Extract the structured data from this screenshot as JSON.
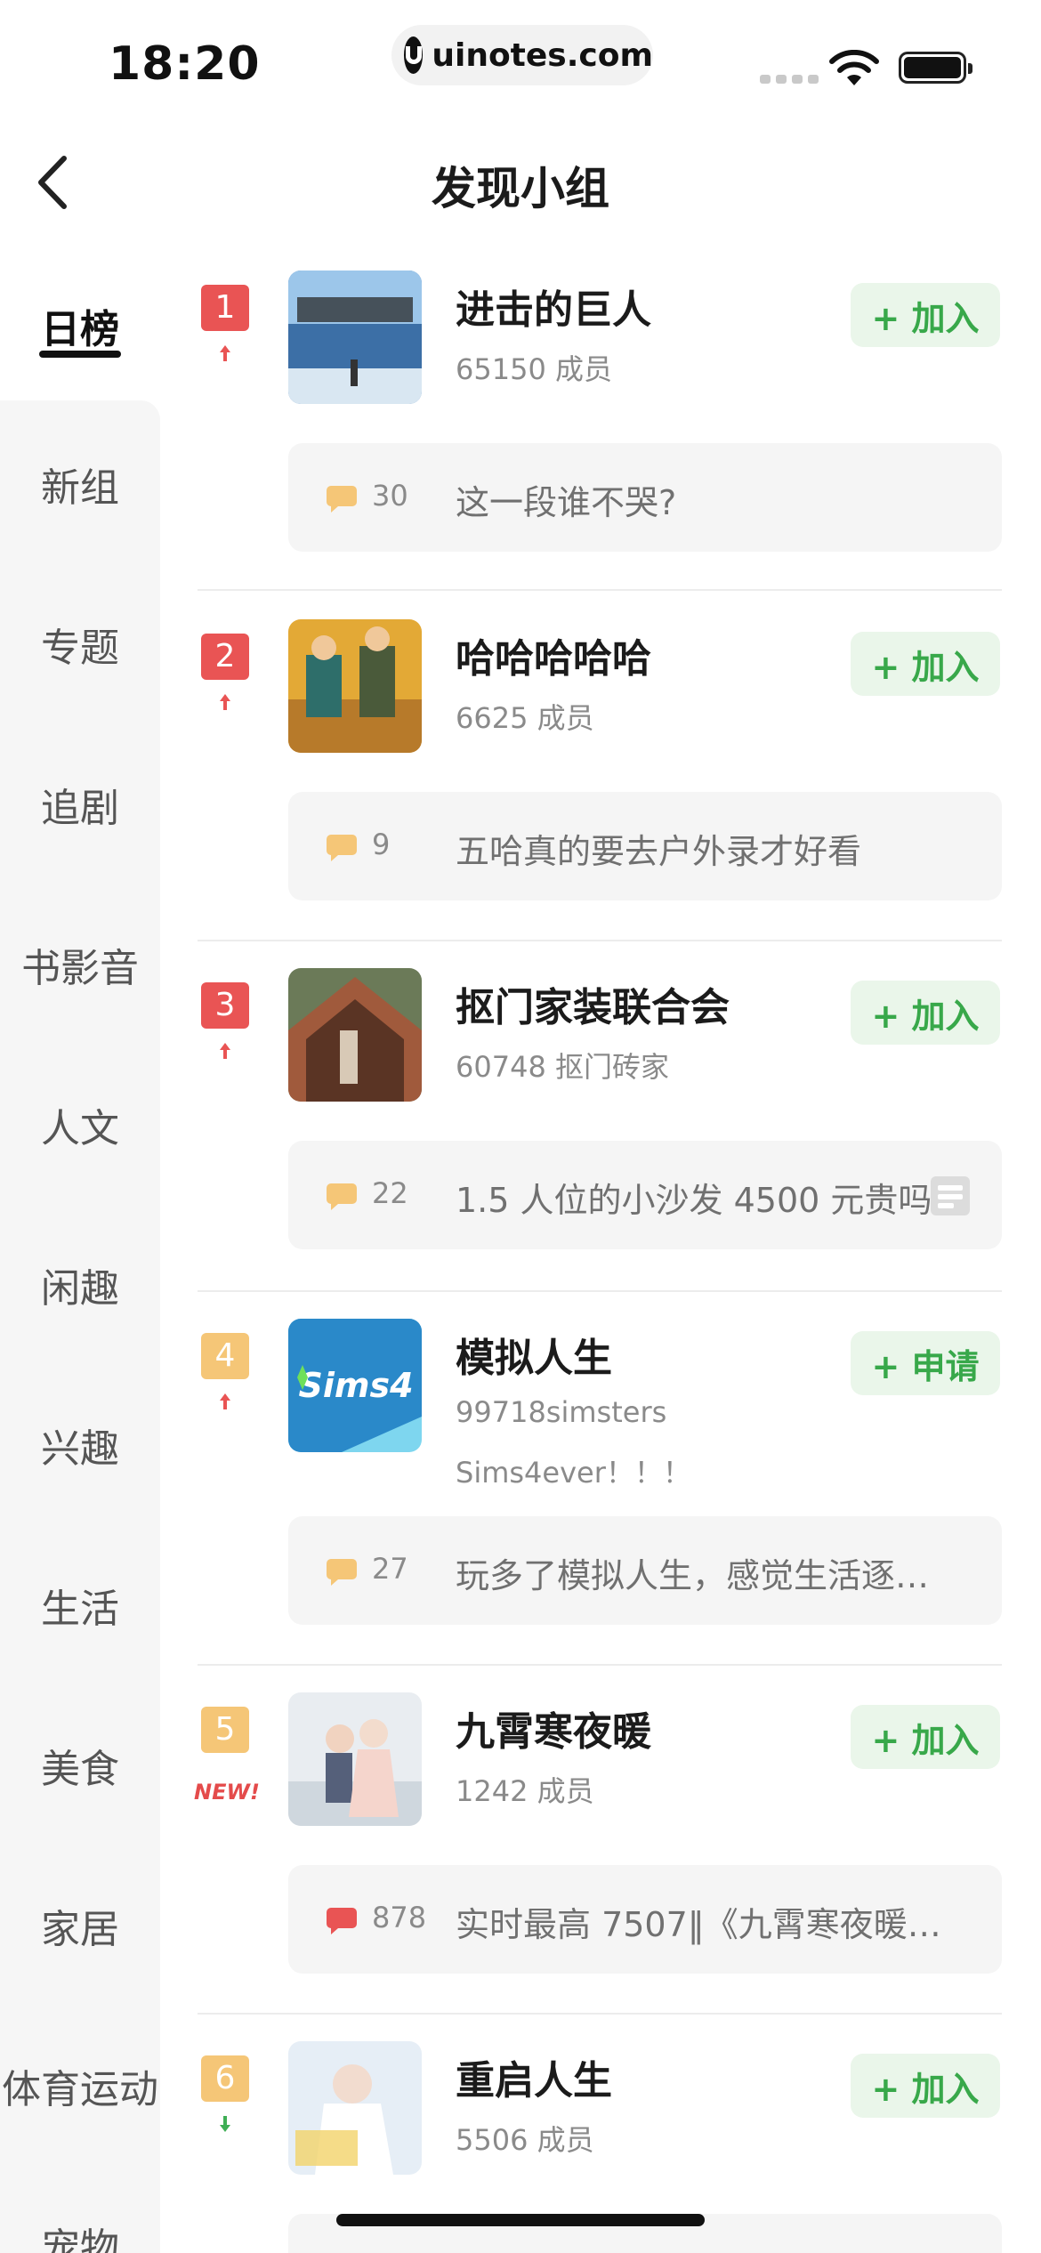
{
  "status_bar": {
    "time": "18:20",
    "url": "uinotes.com",
    "icons": [
      "signal-icon",
      "wifi-icon",
      "battery-icon"
    ]
  },
  "header": {
    "back_icon": "back-chevron-icon",
    "title": "发现小组"
  },
  "sidebar": {
    "items": [
      {
        "label": "日榜",
        "active": true
      },
      {
        "label": "新组"
      },
      {
        "label": "专题"
      },
      {
        "label": "追剧"
      },
      {
        "label": "书影音"
      },
      {
        "label": "人文"
      },
      {
        "label": "闲趣"
      },
      {
        "label": "兴趣"
      },
      {
        "label": "生活"
      },
      {
        "label": "美食"
      },
      {
        "label": "家居"
      },
      {
        "label": "体育运动"
      },
      {
        "label": "宠物"
      }
    ]
  },
  "groups": [
    {
      "rank": "1",
      "trend": "up",
      "name": "进击的巨人",
      "members": "65150 成员",
      "button": "+ 加入",
      "topic": {
        "count": "30",
        "title": "这一段谁不哭?"
      }
    },
    {
      "rank": "2",
      "trend": "up",
      "name": "哈哈哈哈哈",
      "members": "6625 成员",
      "button": "+ 加入",
      "topic": {
        "count": "9",
        "title": "五哈真的要去户外录才好看"
      }
    },
    {
      "rank": "3",
      "trend": "up",
      "name": "抠门家装联合会",
      "members": "60748 抠门砖家",
      "button": "+ 加入",
      "topic": {
        "count": "22",
        "title": "1.5 人位的小沙发 4500 元贵吗"
      }
    },
    {
      "rank": "4",
      "trend": "up",
      "name": "模拟人生",
      "members": "99718simsters",
      "subline": "Sims4ever！！！",
      "button": "+ 申请",
      "cover_text": "Sims4",
      "topic": {
        "count": "27",
        "title": "玩多了模拟人生，感觉生活逐…"
      }
    },
    {
      "rank": "5",
      "trend": "new",
      "new_label": "NEW!",
      "name": "九霄寒夜暖",
      "members": "1242 成员",
      "button": "+ 加入",
      "topic": {
        "count": "878",
        "title": "实时最高 7507‖《九霄寒夜暖…"
      }
    },
    {
      "rank": "6",
      "trend": "down",
      "name": "重启人生",
      "members": "5506 成员",
      "button": "+ 加入"
    }
  ],
  "colors": {
    "rank_top3": "#e95454",
    "rank_other": "#f5c677",
    "join_text": "#38a84a",
    "join_bg": "#eaf6ea",
    "trend_up": "#e95454",
    "trend_down": "#3fae55",
    "hot_bubble": "#e95454",
    "bubble": "#f5c677"
  }
}
